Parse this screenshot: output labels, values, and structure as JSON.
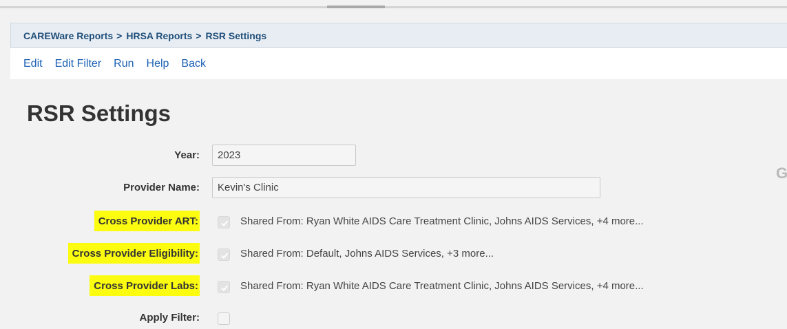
{
  "breadcrumb": [
    {
      "label": "CAREWare Reports"
    },
    {
      "label": "HRSA Reports"
    },
    {
      "label": "RSR Settings"
    }
  ],
  "breadcrumb_separator": ">",
  "menu": {
    "items": [
      {
        "label": "Edit"
      },
      {
        "label": "Edit Filter"
      },
      {
        "label": "Run"
      },
      {
        "label": "Help"
      },
      {
        "label": "Back"
      }
    ]
  },
  "page": {
    "title": "RSR Settings",
    "partial_text": "G"
  },
  "form": {
    "year": {
      "label": "Year:",
      "value": "2023"
    },
    "provider_name": {
      "label": "Provider Name:",
      "value": "Kevin's Clinic"
    },
    "cross_provider_art": {
      "label": "Cross Provider ART:",
      "checked": true,
      "shared_text": "Shared From: Ryan White AIDS Care Treatment Clinic, Johns AIDS Services, +4 more..."
    },
    "cross_provider_eligibility": {
      "label": "Cross Provider Eligibility:",
      "checked": true,
      "shared_text": "Shared From: Default, Johns AIDS Services, +3 more..."
    },
    "cross_provider_labs": {
      "label": "Cross Provider Labs:",
      "checked": true,
      "shared_text": "Shared From: Ryan White AIDS Care Treatment Clinic, Johns AIDS Services, +4 more..."
    },
    "apply_filter": {
      "label": "Apply Filter:",
      "checked": false
    }
  },
  "colors": {
    "highlight": "#fcfc10",
    "link": "#1a5fb4",
    "breadcrumb": "#1f4e79",
    "background": "#f2f2f2"
  }
}
